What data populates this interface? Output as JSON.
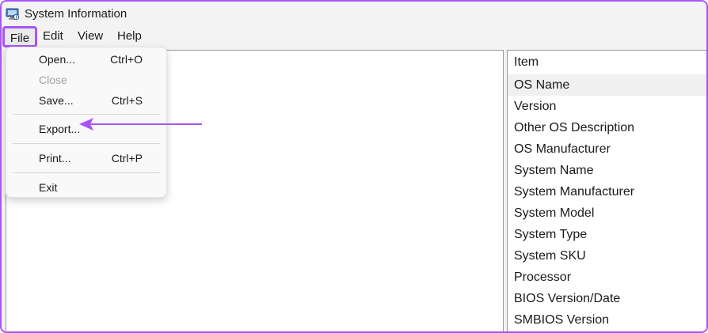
{
  "window": {
    "title": "System Information",
    "icon": "system-information-icon"
  },
  "menubar": {
    "file": "File",
    "edit": "Edit",
    "view": "View",
    "help": "Help"
  },
  "file_menu": {
    "open": {
      "label": "Open...",
      "shortcut": "Ctrl+O"
    },
    "close": {
      "label": "Close"
    },
    "save": {
      "label": "Save...",
      "shortcut": "Ctrl+S"
    },
    "export": {
      "label": "Export..."
    },
    "print": {
      "label": "Print...",
      "shortcut": "Ctrl+P"
    },
    "exit": {
      "label": "Exit"
    }
  },
  "details_list": {
    "column_header": "Item",
    "rows": [
      "OS Name",
      "Version",
      "Other OS Description",
      "OS Manufacturer",
      "System Name",
      "System Manufacturer",
      "System Model",
      "System Type",
      "System SKU",
      "Processor",
      "BIOS Version/Date",
      "SMBIOS Version"
    ],
    "selected_row": "OS Name"
  },
  "annotation": {
    "highlight_color": "#a855f7",
    "arrow_target": "Export..."
  }
}
